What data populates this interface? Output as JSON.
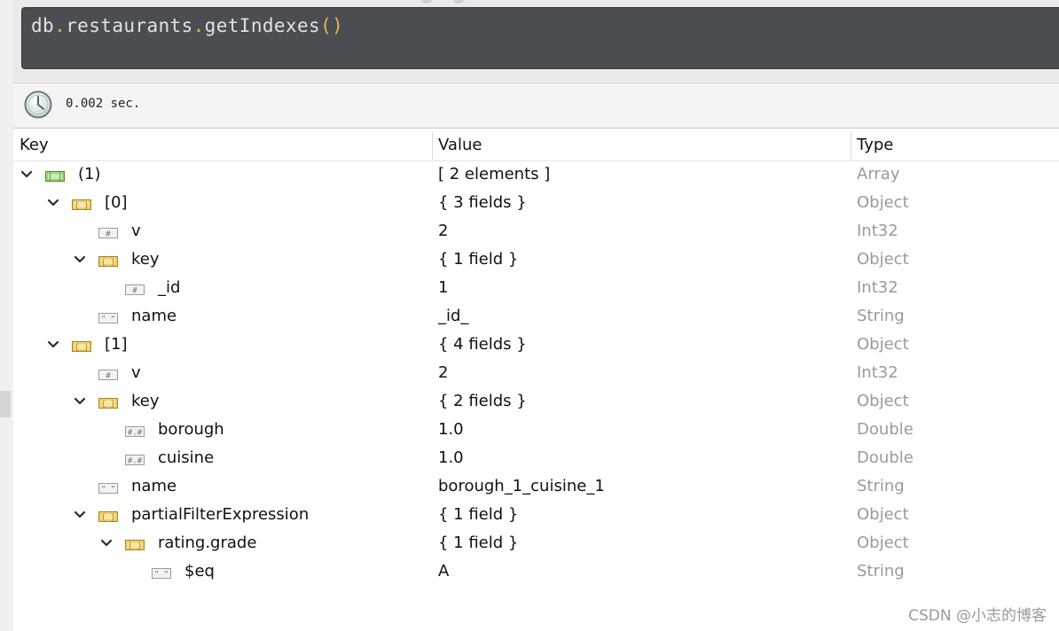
{
  "query": {
    "tokens": [
      {
        "text": "db",
        "kind": "ident"
      },
      {
        "text": ".",
        "kind": "dot"
      },
      {
        "text": "restaurants",
        "kind": "ident"
      },
      {
        "text": ".",
        "kind": "dot"
      },
      {
        "text": "getIndexes",
        "kind": "ident"
      },
      {
        "text": "()",
        "kind": "paren"
      }
    ],
    "colors": {
      "ident": "#e2e2e2",
      "dot": "#e5b64c",
      "paren": "#e5b64c"
    }
  },
  "status": {
    "time": "0.002 sec.",
    "icon": "clock-icon"
  },
  "columns": {
    "key": "Key",
    "value": "Value",
    "type": "Type"
  },
  "rows": [
    {
      "level": 0,
      "expandable": true,
      "icon": "array",
      "key": "(1)",
      "value": "[ 2 elements ]",
      "type": "Array"
    },
    {
      "level": 1,
      "expandable": true,
      "icon": "object",
      "key": "[0]",
      "value": "{ 3 fields }",
      "type": "Object"
    },
    {
      "level": 2,
      "expandable": false,
      "icon": "int",
      "key": "v",
      "value": "2",
      "type": "Int32"
    },
    {
      "level": 2,
      "expandable": true,
      "icon": "object",
      "key": "key",
      "value": "{ 1 field }",
      "type": "Object"
    },
    {
      "level": 3,
      "expandable": false,
      "icon": "int",
      "key": "_id",
      "value": "1",
      "type": "Int32"
    },
    {
      "level": 2,
      "expandable": false,
      "icon": "string",
      "key": "name",
      "value": "_id_",
      "type": "String"
    },
    {
      "level": 1,
      "expandable": true,
      "icon": "object",
      "key": "[1]",
      "value": "{ 4 fields }",
      "type": "Object"
    },
    {
      "level": 2,
      "expandable": false,
      "icon": "int",
      "key": "v",
      "value": "2",
      "type": "Int32"
    },
    {
      "level": 2,
      "expandable": true,
      "icon": "object",
      "key": "key",
      "value": "{ 2 fields }",
      "type": "Object"
    },
    {
      "level": 3,
      "expandable": false,
      "icon": "double",
      "key": "borough",
      "value": "1.0",
      "type": "Double"
    },
    {
      "level": 3,
      "expandable": false,
      "icon": "double",
      "key": "cuisine",
      "value": "1.0",
      "type": "Double"
    },
    {
      "level": 2,
      "expandable": false,
      "icon": "string",
      "key": "name",
      "value": "borough_1_cuisine_1",
      "type": "String"
    },
    {
      "level": 2,
      "expandable": true,
      "icon": "object",
      "key": "partialFilterExpression",
      "value": "{ 1 field }",
      "type": "Object"
    },
    {
      "level": 3,
      "expandable": true,
      "icon": "object",
      "key": "rating.grade",
      "value": "{ 1 field }",
      "type": "Object"
    },
    {
      "level": 4,
      "expandable": false,
      "icon": "string",
      "key": "$eq",
      "value": "A",
      "type": "String"
    }
  ],
  "watermark": "CSDN @小志的博客"
}
